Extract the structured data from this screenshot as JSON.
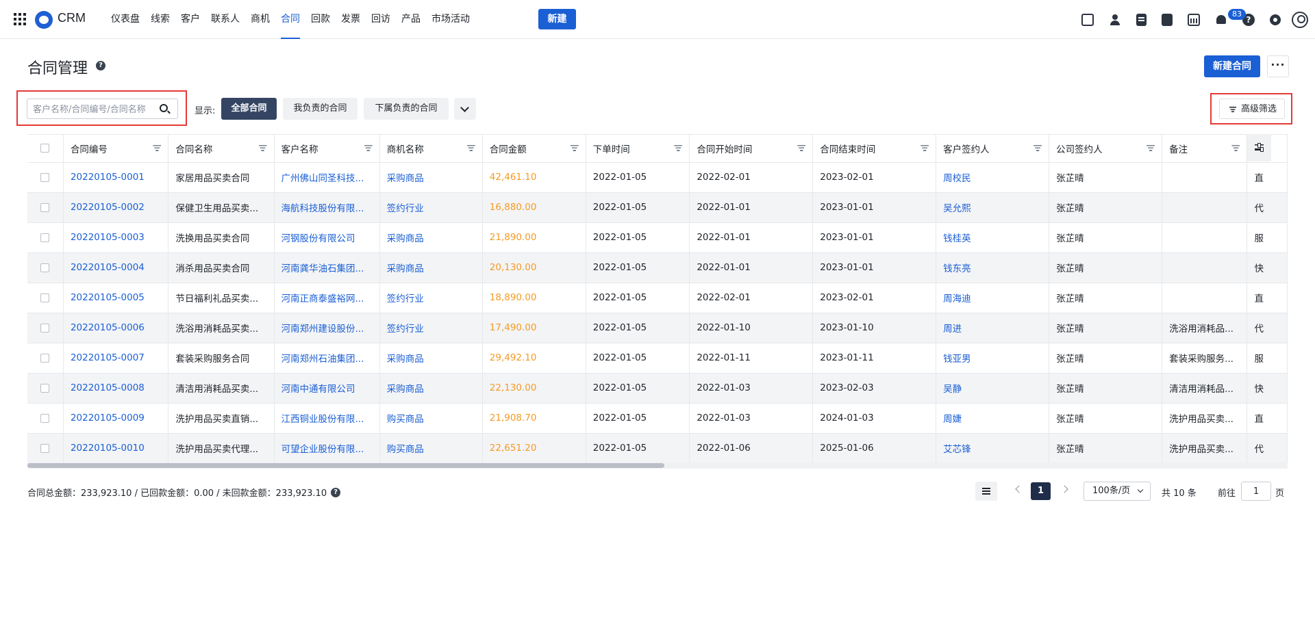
{
  "app": {
    "name": "CRM"
  },
  "nav": {
    "items": [
      "仪表盘",
      "线索",
      "客户",
      "联系人",
      "商机",
      "合同",
      "回款",
      "发票",
      "回访",
      "产品",
      "市场活动"
    ],
    "active_index": 5,
    "new_label": "新建",
    "notification_count": "83",
    "help_glyph": "?",
    "icons": [
      "task-check-icon",
      "person-icon",
      "document-icon",
      "phone-icon",
      "calendar-icon",
      "bell-icon",
      "help-icon",
      "gear-icon",
      "avatar-icon"
    ]
  },
  "page": {
    "title": "合同管理",
    "title_help": "?",
    "new_contract_label": "新建合同",
    "more_label": "···"
  },
  "filters": {
    "search_placeholder": "客户名称/合同编号/合同名称",
    "show_label": "显示:",
    "segments": [
      "全部合同",
      "我负责的合同",
      "下属负责的合同"
    ],
    "active_segment": 0,
    "advanced_label": "高级筛选"
  },
  "table": {
    "columns": [
      "合同编号",
      "合同名称",
      "客户名称",
      "商机名称",
      "合同金额",
      "下单时间",
      "合同开始时间",
      "合同结束时间",
      "客户签约人",
      "公司签约人",
      "备注",
      ""
    ],
    "rows": [
      [
        "20220105-0001",
        "家居用品买卖合同",
        "广州佛山同圣科技...",
        "采购商品",
        "42,461.10",
        "2022-01-05",
        "2022-02-01",
        "2023-02-01",
        "周校民",
        "张芷晴",
        "",
        "直"
      ],
      [
        "20220105-0002",
        "保健卫生用品买卖...",
        "海航科技股份有限...",
        "签约行业",
        "16,880.00",
        "2022-01-05",
        "2022-01-01",
        "2023-01-01",
        "吴允熙",
        "张芷晴",
        "",
        "代"
      ],
      [
        "20220105-0003",
        "洗换用品买卖合同",
        "河钢股份有限公司",
        "采购商品",
        "21,890.00",
        "2022-01-05",
        "2022-01-01",
        "2023-01-01",
        "钱桂英",
        "张芷晴",
        "",
        "服"
      ],
      [
        "20220105-0004",
        "消杀用品买卖合同",
        "河南龚华油石集团...",
        "采购商品",
        "20,130.00",
        "2022-01-05",
        "2022-01-01",
        "2023-01-01",
        "钱东亮",
        "张芷晴",
        "",
        "快"
      ],
      [
        "20220105-0005",
        "节日福利礼品买卖...",
        "河南正商泰盛裕网...",
        "签约行业",
        "18,890.00",
        "2022-01-05",
        "2022-02-01",
        "2023-02-01",
        "周海迪",
        "张芷晴",
        "",
        "直"
      ],
      [
        "20220105-0006",
        "洗浴用消耗品买卖...",
        "河南郑州建设股份...",
        "签约行业",
        "17,490.00",
        "2022-01-05",
        "2022-01-10",
        "2023-01-10",
        "周进",
        "张芷晴",
        "洗浴用消耗品...",
        "代"
      ],
      [
        "20220105-0007",
        "套装采购服务合同",
        "河南郑州石油集团...",
        "采购商品",
        "29,492.10",
        "2022-01-05",
        "2022-01-11",
        "2023-01-11",
        "钱亚男",
        "张芷晴",
        "套装采购服务...",
        "服"
      ],
      [
        "20220105-0008",
        "清洁用消耗品买卖...",
        "河南中通有限公司",
        "采购商品",
        "22,130.00",
        "2022-01-05",
        "2022-01-03",
        "2023-02-03",
        "吴静",
        "张芷晴",
        "清洁用消耗品...",
        "快"
      ],
      [
        "20220105-0009",
        "洗护用品买卖直销...",
        "江西铜业股份有限...",
        "购买商品",
        "21,908.70",
        "2022-01-05",
        "2022-01-03",
        "2024-01-03",
        "周婕",
        "张芷晴",
        "洗护用品买卖...",
        "直"
      ],
      [
        "20220105-0010",
        "洗护用品买卖代理...",
        "可望企业股份有限...",
        "购买商品",
        "22,651.20",
        "2022-01-05",
        "2022-01-06",
        "2025-01-06",
        "艾芯锋",
        "张芷晴",
        "洗护用品买卖...",
        "代"
      ]
    ]
  },
  "footer": {
    "summary": "合同总金额：233,923.10 / 已回款金额：0.00 / 未回款金额：233,923.10",
    "summary_help": "?",
    "current_page": "1",
    "page_size": "100条/页",
    "total": "共 10 条",
    "goto_label": "前往",
    "goto_value": "1",
    "page_unit": "页"
  },
  "colors": {
    "primary": "#1a5fd4",
    "amount": "#f59a23",
    "active_segment": "#344564",
    "highlight": "#e53935"
  }
}
